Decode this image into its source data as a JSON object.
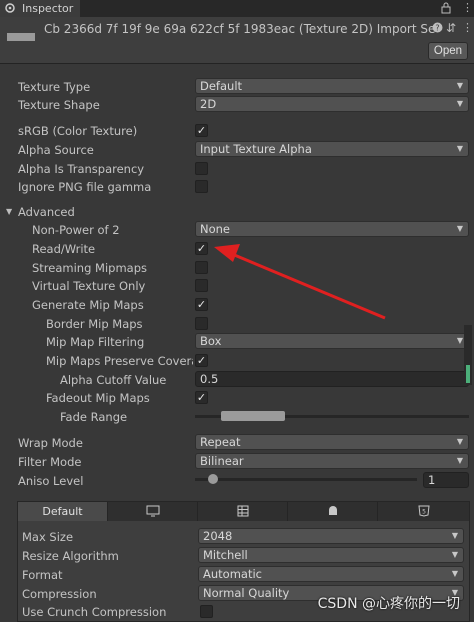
{
  "tab": {
    "label": "Inspector",
    "icon": "inspector-icon"
  },
  "header": {
    "title": "Cb 2366d 7f 19f 9e 69a 622cf 5f 1983eac (Texture 2D) Import Se",
    "open_label": "Open"
  },
  "fields": {
    "texture_type": {
      "label": "Texture Type",
      "value": "Default"
    },
    "texture_shape": {
      "label": "Texture Shape",
      "value": "2D"
    },
    "srgb": {
      "label": "sRGB (Color Texture)",
      "checked": true
    },
    "alpha_source": {
      "label": "Alpha Source",
      "value": "Input Texture Alpha"
    },
    "alpha_transparency": {
      "label": "Alpha Is Transparency",
      "checked": false
    },
    "ignore_png_gamma": {
      "label": "Ignore PNG file gamma",
      "checked": false
    },
    "advanced": {
      "label": "Advanced"
    },
    "non_power_of_2": {
      "label": "Non-Power of 2",
      "value": "None"
    },
    "read_write": {
      "label": "Read/Write",
      "checked": true
    },
    "streaming_mipmaps": {
      "label": "Streaming Mipmaps",
      "checked": false
    },
    "virtual_texture_only": {
      "label": "Virtual Texture Only",
      "checked": false
    },
    "generate_mip_maps": {
      "label": "Generate Mip Maps",
      "checked": true
    },
    "border_mip_maps": {
      "label": "Border Mip Maps",
      "checked": false
    },
    "mip_map_filtering": {
      "label": "Mip Map Filtering",
      "value": "Box"
    },
    "mip_maps_preserve_coverage": {
      "label": "Mip Maps Preserve Coverag",
      "checked": true
    },
    "alpha_cutoff_value": {
      "label": "Alpha Cutoff Value",
      "value": "0.5"
    },
    "fadeout_mip_maps": {
      "label": "Fadeout Mip Maps",
      "checked": true
    },
    "fade_range": {
      "label": "Fade Range"
    },
    "wrap_mode": {
      "label": "Wrap Mode",
      "value": "Repeat"
    },
    "filter_mode": {
      "label": "Filter Mode",
      "value": "Bilinear"
    },
    "aniso_level": {
      "label": "Aniso Level",
      "value": "1"
    }
  },
  "platform": {
    "tabs": [
      "Default",
      "monitor-icon",
      "grid-icon",
      "android-icon",
      "html5-icon"
    ],
    "max_size": {
      "label": "Max Size",
      "value": "2048"
    },
    "resize_algorithm": {
      "label": "Resize Algorithm",
      "value": "Mitchell"
    },
    "format": {
      "label": "Format",
      "value": "Automatic"
    },
    "compression": {
      "label": "Compression",
      "value": "Normal Quality"
    },
    "use_crunch": {
      "label": "Use Crunch Compression",
      "checked": false
    }
  },
  "watermark": "CSDN @心疼你的一切",
  "colors": {
    "background": "#383838",
    "annotation_arrow": "#e02020"
  }
}
